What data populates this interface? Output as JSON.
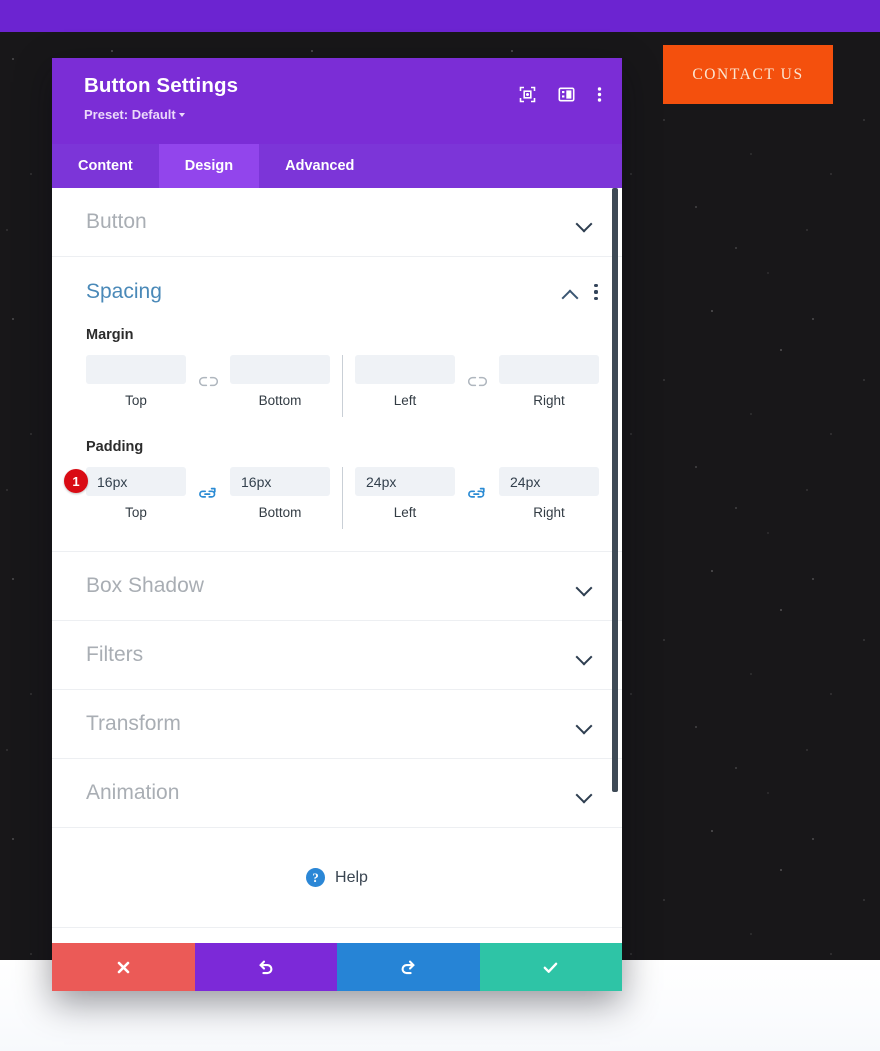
{
  "site": {
    "contact_button_label": "CONTACT US",
    "colors": {
      "topbar": "#6C24D1",
      "hero_background": "#181719",
      "contact_button": "#F4500D",
      "contact_button_text": "#FBE6D2"
    }
  },
  "modal": {
    "title": "Button Settings",
    "preset_label": "Preset: Default",
    "header_icons": [
      {
        "name": "focus-target-icon"
      },
      {
        "name": "layout-panel-icon"
      },
      {
        "name": "kebab-menu-icon"
      }
    ],
    "tabs": [
      {
        "label": "Content",
        "active": false
      },
      {
        "label": "Design",
        "active": true
      },
      {
        "label": "Advanced",
        "active": false
      }
    ],
    "sections": [
      {
        "label": "Button",
        "expanded": false
      },
      {
        "label": "Box Shadow",
        "expanded": false
      },
      {
        "label": "Filters",
        "expanded": false
      },
      {
        "label": "Transform",
        "expanded": false
      },
      {
        "label": "Animation",
        "expanded": false
      }
    ],
    "spacing": {
      "title": "Spacing",
      "expanded": true,
      "margin": {
        "label": "Margin",
        "linked_vertical": false,
        "linked_horizontal": false,
        "fields": [
          {
            "sub": "Top",
            "value": "",
            "placeholder": ""
          },
          {
            "sub": "Bottom",
            "value": "",
            "placeholder": ""
          },
          {
            "sub": "Left",
            "value": "",
            "placeholder": ""
          },
          {
            "sub": "Right",
            "value": "",
            "placeholder": ""
          }
        ]
      },
      "padding": {
        "label": "Padding",
        "badge": "1",
        "linked_vertical": true,
        "linked_horizontal": true,
        "fields": [
          {
            "sub": "Top",
            "value": "16px",
            "placeholder": ""
          },
          {
            "sub": "Bottom",
            "value": "16px",
            "placeholder": ""
          },
          {
            "sub": "Left",
            "value": "24px",
            "placeholder": ""
          },
          {
            "sub": "Right",
            "value": "24px",
            "placeholder": ""
          }
        ]
      }
    },
    "help": {
      "label": "Help",
      "icon_glyph": "?"
    },
    "footer_buttons": [
      {
        "name": "discard",
        "icon": "close-icon",
        "color": "#EB5A57"
      },
      {
        "name": "undo",
        "icon": "undo-icon",
        "color": "#7C29D8"
      },
      {
        "name": "redo",
        "icon": "redo-icon",
        "color": "#2684D6"
      },
      {
        "name": "save",
        "icon": "check-icon",
        "color": "#2EC4A6"
      }
    ]
  }
}
